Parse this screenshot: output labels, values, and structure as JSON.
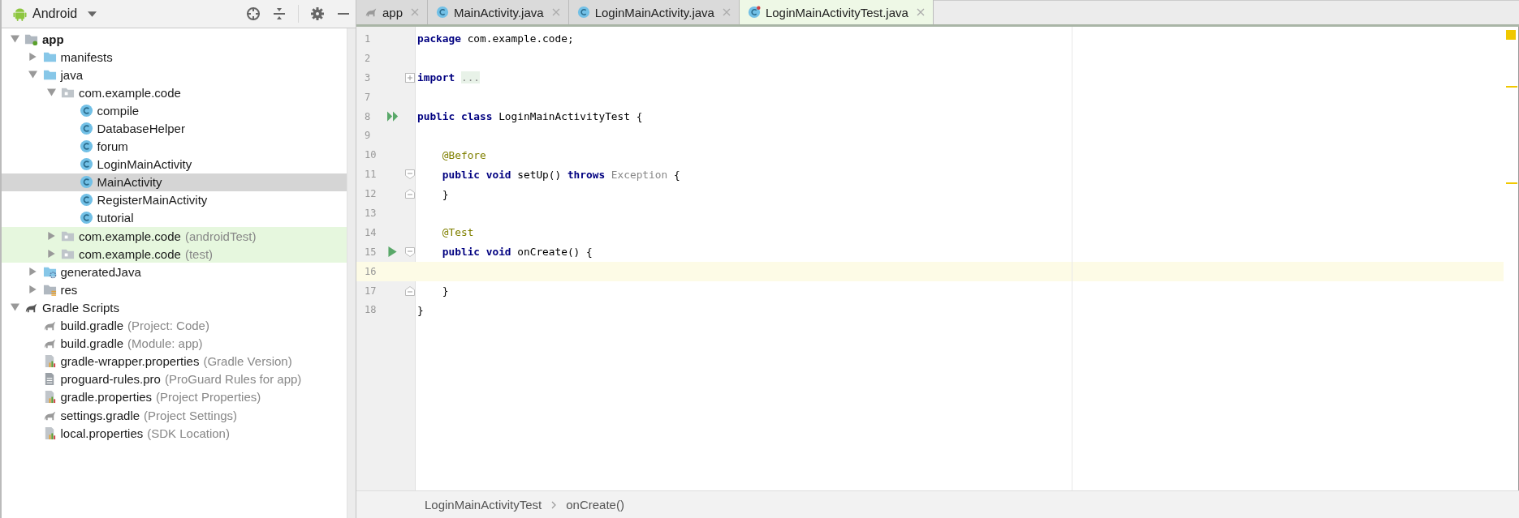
{
  "project_panel": {
    "view": "Android",
    "tree": [
      {
        "label": "app",
        "kind": "module",
        "bold": true,
        "expanded": true,
        "selected": false,
        "test_root": false,
        "children": [
          {
            "label": "manifests",
            "kind": "folder",
            "expanded": false,
            "selected": false,
            "test_root": false
          },
          {
            "label": "java",
            "kind": "folder",
            "expanded": true,
            "selected": false,
            "test_root": false,
            "children": [
              {
                "label": "com.example.code",
                "kind": "package",
                "expanded": true,
                "selected": false,
                "test_root": false,
                "children": [
                  {
                    "label": "compile",
                    "kind": "class",
                    "selected": false,
                    "test_root": false
                  },
                  {
                    "label": "DatabaseHelper",
                    "kind": "class",
                    "selected": false,
                    "test_root": false
                  },
                  {
                    "label": "forum",
                    "kind": "class",
                    "selected": false,
                    "test_root": false
                  },
                  {
                    "label": "LoginMainActivity",
                    "kind": "class",
                    "selected": false,
                    "test_root": false
                  },
                  {
                    "label": "MainActivity",
                    "kind": "class",
                    "selected": true,
                    "test_root": false
                  },
                  {
                    "label": "RegisterMainActivity",
                    "kind": "class",
                    "selected": false,
                    "test_root": false
                  },
                  {
                    "label": "tutorial",
                    "kind": "class",
                    "selected": false,
                    "test_root": false
                  }
                ]
              },
              {
                "label": "com.example.code",
                "hint": "(androidTest)",
                "kind": "package",
                "expanded": false,
                "selected": false,
                "test_root": true
              },
              {
                "label": "com.example.code",
                "hint": "(test)",
                "kind": "package",
                "expanded": false,
                "selected": false,
                "test_root": true
              }
            ]
          },
          {
            "label": "generatedJava",
            "kind": "generated",
            "expanded": false,
            "selected": false,
            "test_root": false
          },
          {
            "label": "res",
            "kind": "res",
            "expanded": false,
            "selected": false,
            "test_root": false
          }
        ]
      },
      {
        "label": "Gradle Scripts",
        "kind": "gradle",
        "expanded": true,
        "selected": false,
        "test_root": false,
        "children": [
          {
            "label": "build.gradle",
            "hint": "(Project: Code)",
            "kind": "script",
            "selected": false,
            "test_root": false
          },
          {
            "label": "build.gradle",
            "hint": "(Module: app)",
            "kind": "script",
            "selected": false,
            "test_root": false
          },
          {
            "label": "gradle-wrapper.properties",
            "hint": "(Gradle Version)",
            "kind": "properties",
            "selected": false,
            "test_root": false
          },
          {
            "label": "proguard-rules.pro",
            "hint": "(ProGuard Rules for app)",
            "kind": "text",
            "selected": false,
            "test_root": false
          },
          {
            "label": "gradle.properties",
            "hint": "(Project Properties)",
            "kind": "properties",
            "selected": false,
            "test_root": false
          },
          {
            "label": "settings.gradle",
            "hint": "(Project Settings)",
            "kind": "script",
            "selected": false,
            "test_root": false
          },
          {
            "label": "local.properties",
            "hint": "(SDK Location)",
            "kind": "properties",
            "selected": false,
            "test_root": false
          }
        ]
      }
    ]
  },
  "tabs": [
    {
      "label": "app",
      "kind": "script",
      "selected": false
    },
    {
      "label": "MainActivity.java",
      "kind": "class",
      "selected": false
    },
    {
      "label": "LoginMainActivity.java",
      "kind": "class",
      "selected": false
    },
    {
      "label": "LoginMainActivityTest.java",
      "kind": "test",
      "selected": true
    }
  ],
  "editor": {
    "lines": [
      {
        "number": "1",
        "current": false,
        "tokens": [
          {
            "text": "package",
            "kind": "keyword"
          },
          {
            "text": " com.example.code;",
            "kind": "plain"
          }
        ]
      },
      {
        "number": "2",
        "current": false
      },
      {
        "number": "3",
        "current": false,
        "kind": "folded",
        "tokens": [
          {
            "text": "import",
            "kind": "keyword"
          },
          {
            "text": "...",
            "kind": "folded"
          }
        ]
      },
      {
        "number": "7",
        "current": false
      },
      {
        "number": "8",
        "current": false,
        "kind": "testclass",
        "tokens": [
          {
            "text": "public class",
            "kind": "keyword"
          },
          {
            "text": " LoginMainActivityTest {",
            "kind": "plain"
          }
        ]
      },
      {
        "number": "9",
        "current": false
      },
      {
        "number": "10",
        "current": false,
        "indented": true,
        "tokens": [
          {
            "text": "@Before",
            "kind": "annotation"
          }
        ]
      },
      {
        "number": "11",
        "current": false,
        "indented": true,
        "kind": "blockstart",
        "tokens": [
          {
            "text": "public void",
            "kind": "keyword"
          },
          {
            "text": " setUp() ",
            "kind": "plain"
          },
          {
            "text": "throws",
            "kind": "keyword"
          },
          {
            "text": " Exception",
            "kind": "dim"
          },
          {
            "text": " {",
            "kind": "plain"
          }
        ]
      },
      {
        "number": "12",
        "current": false,
        "indented": true,
        "kind": "blockend",
        "tokens": [
          {
            "text": "}",
            "kind": "plain"
          }
        ]
      },
      {
        "number": "13",
        "current": false
      },
      {
        "number": "14",
        "current": false,
        "indented": true,
        "tokens": [
          {
            "text": "@Test",
            "kind": "annotation"
          }
        ]
      },
      {
        "number": "15",
        "current": false,
        "indented": true,
        "kind": "testmethod",
        "tokens": [
          {
            "text": "public void",
            "kind": "keyword"
          },
          {
            "text": " onCreate() {",
            "kind": "plain"
          }
        ]
      },
      {
        "number": "16",
        "current": true
      },
      {
        "number": "17",
        "current": false,
        "indented": true,
        "kind": "blockend",
        "tokens": [
          {
            "text": "}",
            "kind": "plain"
          }
        ]
      },
      {
        "number": "18",
        "current": false,
        "tokens": [
          {
            "text": "}",
            "kind": "plain"
          }
        ]
      }
    ],
    "breadcrumbs": [
      "LoginMainActivityTest",
      "onCreate()"
    ]
  }
}
